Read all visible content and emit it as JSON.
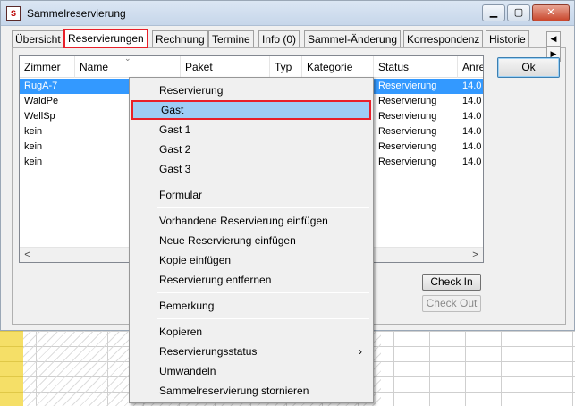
{
  "window": {
    "title": "Sammelreservierung"
  },
  "tabs": [
    {
      "label": "Übersicht"
    },
    {
      "label": "Reservierungen"
    },
    {
      "label": "Rechnung"
    },
    {
      "label": "Termine"
    },
    {
      "label": "Info (0)"
    },
    {
      "label": "Sammel-Änderung"
    },
    {
      "label": "Korrespondenz"
    },
    {
      "label": "Historie"
    }
  ],
  "table": {
    "columns": [
      "Zimmer",
      "Name",
      "Paket",
      "Typ",
      "Kategorie",
      "Status",
      "Anre"
    ],
    "rows": [
      {
        "zimmer": "RugA-7",
        "status": "Reservierung",
        "anreise": "14.0"
      },
      {
        "zimmer": "WaldPe",
        "status": "Reservierung",
        "anreise": "14.0"
      },
      {
        "zimmer": "WellSp",
        "status": "Reservierung",
        "anreise": "14.0"
      },
      {
        "zimmer": "kein",
        "status": "Reservierung",
        "anreise": "14.0"
      },
      {
        "zimmer": "kein",
        "status": "Reservierung",
        "anreise": "14.0"
      },
      {
        "zimmer": "kein",
        "status": "Reservierung",
        "anreise": "14.0"
      }
    ]
  },
  "buttons": {
    "ok": "Ok",
    "check_in": "Check In",
    "check_out": "Check Out"
  },
  "context_menu": {
    "items": [
      {
        "label": "Reservierung"
      },
      {
        "label": "Gast"
      },
      {
        "label": "Gast 1"
      },
      {
        "label": "Gast 2"
      },
      {
        "label": "Gast 3"
      },
      {
        "label": "Formular"
      },
      {
        "label": "Vorhandene Reservierung einfügen"
      },
      {
        "label": "Neue Reservierung einfügen"
      },
      {
        "label": "Kopie einfügen"
      },
      {
        "label": "Reservierung entfernen"
      },
      {
        "label": "Bemerkung"
      },
      {
        "label": "Kopieren"
      },
      {
        "label": "Reservierungsstatus"
      },
      {
        "label": "Umwandeln"
      },
      {
        "label": "Sammelreservierung stornieren"
      }
    ]
  },
  "colors": {
    "highlight_border": "#e8202a",
    "selection": "#3399ff",
    "menu_highlight": "#9ecdf5"
  }
}
